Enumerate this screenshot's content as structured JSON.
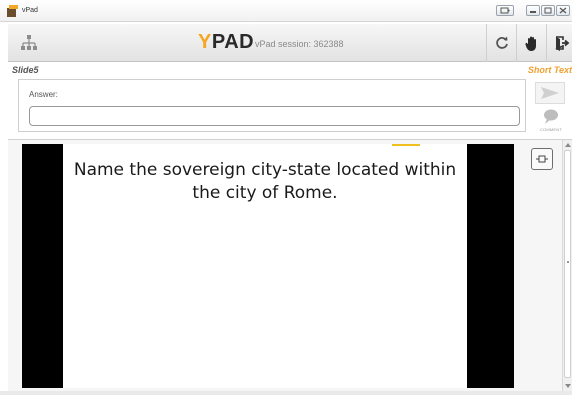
{
  "window": {
    "title": "vPad",
    "icons": [
      "app-icon",
      "screen-share-icon",
      "minimize-icon",
      "maximize-icon",
      "close-icon"
    ]
  },
  "toolbar": {
    "logo_y": "Y",
    "logo_pad": "PAD",
    "session_text": "vPad session: 362388",
    "icons": [
      "network-icon",
      "refresh-icon",
      "raise-hand-icon",
      "exit-icon"
    ]
  },
  "slide_label": "Slide5",
  "question_type": "Short Text",
  "answer": {
    "label": "Answer:",
    "value": "",
    "placeholder": ""
  },
  "actions": {
    "send_icon": "send-arrow-icon",
    "comment_label": "COMMENT"
  },
  "slide": {
    "question_text": "Name the sovereign city-state located within the city of Rome.",
    "expand_icon": "expand-icon"
  },
  "colors": {
    "accent_orange": "#f5a623",
    "question_type_color": "#f0a030",
    "toolbar_bg": "#e8e8e8",
    "slide_border": "#000000"
  }
}
